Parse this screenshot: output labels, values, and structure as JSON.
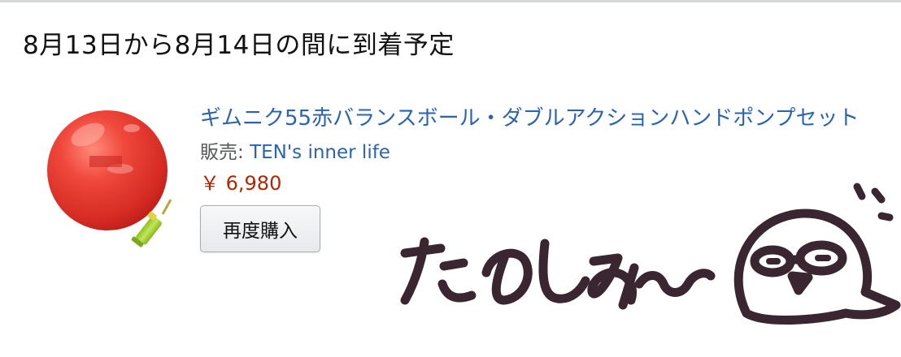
{
  "delivery": {
    "text": "8月13日から8月14日の間に到着予定"
  },
  "product": {
    "title": "ギムニク55赤バランスボール・ダブルアクションハンドポンプセット",
    "seller_label": "販売: ",
    "seller_name": "TEN's inner life",
    "price": "￥ 6,980",
    "rebuy_button": "再度購入",
    "image_icon": "red-balance-ball-with-pump-image"
  },
  "doodle": {
    "text": "たのしみ",
    "icon": "bird-with-glasses-doodle"
  },
  "colors": {
    "link": "#2a64b1",
    "price": "#b12704",
    "text": "#111111",
    "muted": "#565959",
    "doodle_ink": "#3a2630",
    "ball": "#e8372f",
    "pump": "#a7d23a"
  }
}
